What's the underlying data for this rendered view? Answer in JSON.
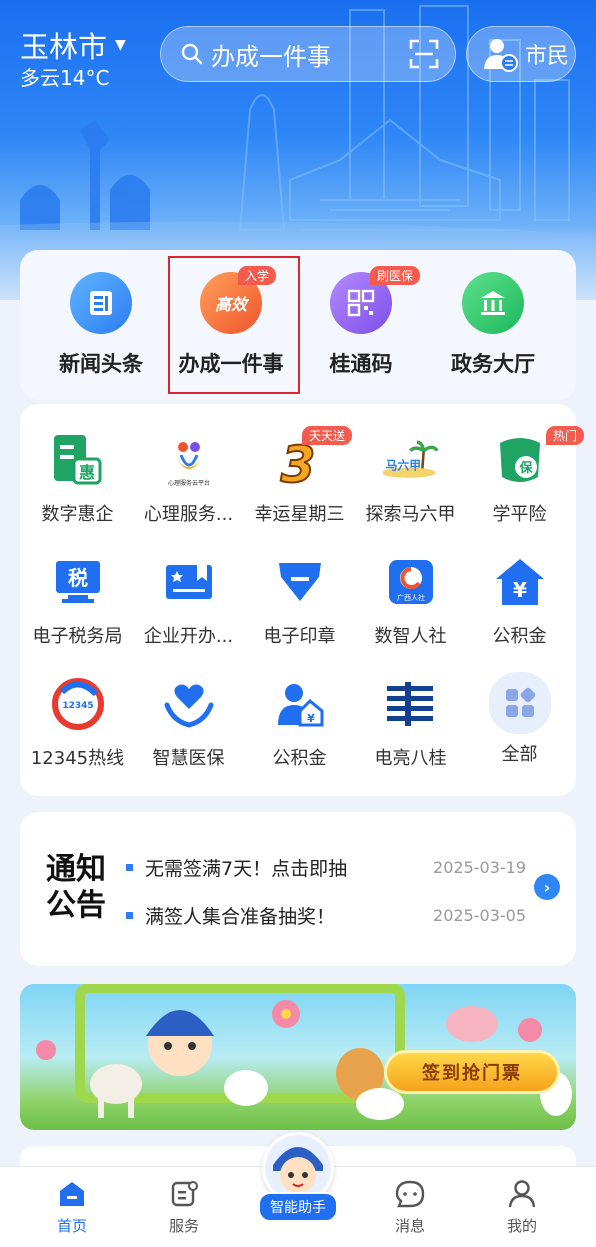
{
  "header": {
    "city": "玉林市",
    "weather": "多云14°C",
    "search_text": "办成一件事",
    "user_mode": "市民"
  },
  "top_services": [
    {
      "label": "新闻头条",
      "icon": "news-icon",
      "tag": ""
    },
    {
      "label": "办成一件事",
      "icon": "gaoban-icon",
      "tag": "入学",
      "icon_text": "高效"
    },
    {
      "label": "桂通码",
      "icon": "qrcode-icon",
      "tag": "刷医保"
    },
    {
      "label": "政务大厅",
      "icon": "government-hall-icon",
      "tag": ""
    }
  ],
  "grid": [
    {
      "label": "数字惠企",
      "icon": "hui-qi-icon",
      "icon_text": "惠",
      "tag": ""
    },
    {
      "label": "心理服务...",
      "icon": "psychology-icon",
      "icon_text": "心理服务云平台",
      "tag": ""
    },
    {
      "label": "幸运星期三",
      "icon": "lucky-wednesday-icon",
      "icon_text": "3",
      "tag": "天天送"
    },
    {
      "label": "探索马六甲",
      "icon": "malacca-icon",
      "icon_text": "马六甲",
      "tag": ""
    },
    {
      "label": "学平险",
      "icon": "student-insurance-icon",
      "icon_text": "保",
      "tag": "热门"
    },
    {
      "label": "电子税务局",
      "icon": "tax-icon",
      "icon_text": "税",
      "tag": ""
    },
    {
      "label": "企业开办...",
      "icon": "business-license-icon",
      "tag": ""
    },
    {
      "label": "电子印章",
      "icon": "e-seal-icon",
      "tag": ""
    },
    {
      "label": "数智人社",
      "icon": "social-security-icon",
      "icon_text": "广西人社",
      "tag": ""
    },
    {
      "label": "公积金",
      "icon": "housing-fund-icon",
      "icon_text": "¥",
      "tag": ""
    },
    {
      "label": "12345热线",
      "icon": "hotline-icon",
      "icon_text": "12345",
      "tag": ""
    },
    {
      "label": "智慧医保",
      "icon": "medical-insurance-icon",
      "tag": ""
    },
    {
      "label": "公积金",
      "icon": "fund-person-icon",
      "icon_text": "¥",
      "tag": ""
    },
    {
      "label": "电亮八桂",
      "icon": "power-grid-icon",
      "tag": ""
    },
    {
      "label": "全部",
      "icon": "all-apps-icon",
      "tag": ""
    }
  ],
  "notice": {
    "title_line1": "通知",
    "title_line2": "公告",
    "items": [
      {
        "text": "无需签满7天！点击即抽",
        "date": "2025-03-19"
      },
      {
        "text": "满签人集合准备抽奖！",
        "date": "2025-03-05"
      }
    ]
  },
  "banner": {
    "button_label": "签到抢门票"
  },
  "tabs": [
    {
      "label": "首页",
      "icon": "home-icon",
      "active": true
    },
    {
      "label": "服务",
      "icon": "service-icon",
      "active": false
    },
    {
      "label": "智能助手",
      "icon": "assistant-avatar",
      "active": false
    },
    {
      "label": "消息",
      "icon": "message-icon",
      "active": false
    },
    {
      "label": "我的",
      "icon": "profile-icon",
      "active": false
    }
  ],
  "colors": {
    "brand_blue": "#1f6ff0",
    "tag_red": "#f35b4e",
    "highlight_red": "#d9262f"
  }
}
